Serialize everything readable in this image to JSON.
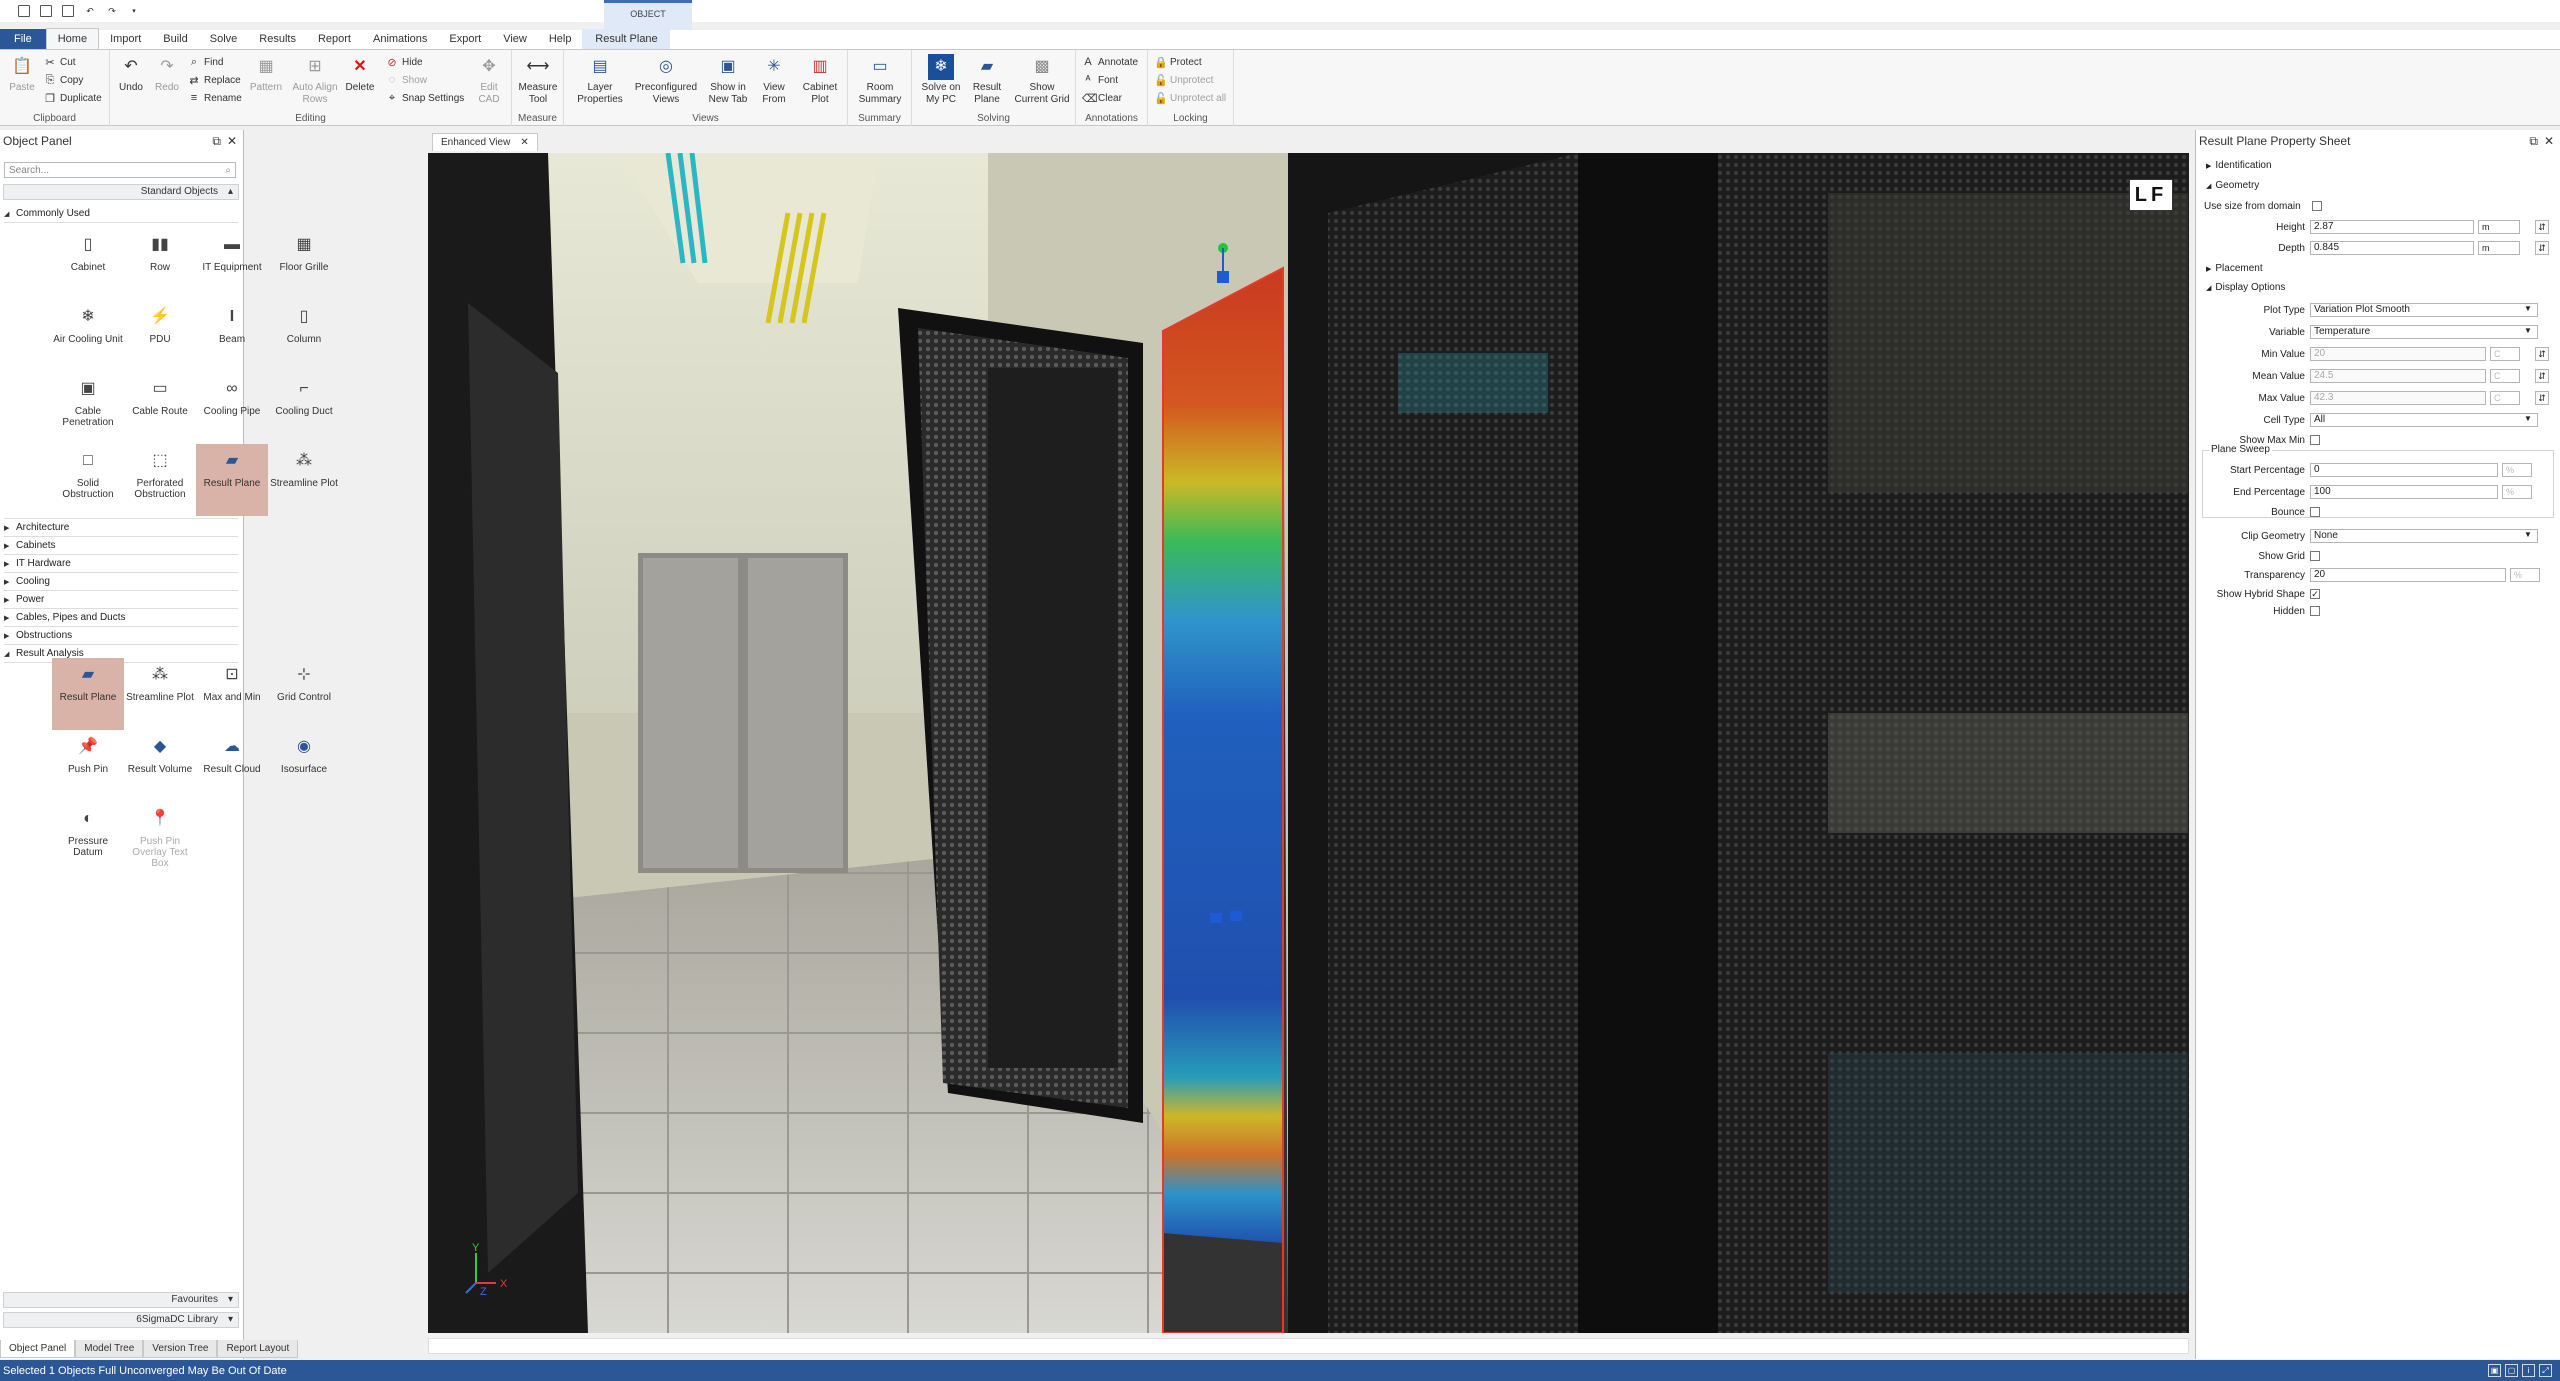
{
  "context_tab": {
    "group_label": "OBJECT"
  },
  "tabs": [
    {
      "label": "File"
    },
    {
      "label": "Home"
    },
    {
      "label": "Import"
    },
    {
      "label": "Build"
    },
    {
      "label": "Solve"
    },
    {
      "label": "Results"
    },
    {
      "label": "Report"
    },
    {
      "label": "Animations"
    },
    {
      "label": "Export"
    },
    {
      "label": "View"
    },
    {
      "label": "Help"
    },
    {
      "label": "Result Plane"
    }
  ],
  "ribbon": {
    "clipboard": {
      "label": "Clipboard",
      "paste": "Paste",
      "cut": "Cut",
      "copy": "Copy",
      "duplicate": "Duplicate"
    },
    "editing": {
      "label": "Editing",
      "undo": "Undo",
      "redo": "Redo",
      "find": "Find",
      "replace": "Replace",
      "rename": "Rename",
      "pattern": "Pattern",
      "auto_align": "Auto Align Rows",
      "delete": "Delete",
      "hide": "Hide",
      "show": "Show",
      "snap_settings": "Snap Settings",
      "edit_cad": "Edit CAD"
    },
    "measure": {
      "label": "Measure",
      "measure_tool": "Measure Tool"
    },
    "views": {
      "label": "Views",
      "layer_properties": "Layer Properties",
      "preconfigured_views": "Preconfigured Views",
      "show_in_new_tab": "Show in New Tab",
      "view_from": "View From",
      "cabinet_plot": "Cabinet Plot"
    },
    "summary": {
      "label": "Summary",
      "room_summary": "Room Summary"
    },
    "solving": {
      "label": "Solving",
      "solve_on_my_pc": "Solve on My PC",
      "result_plane": "Result Plane",
      "show_current_grid": "Show Current Grid"
    },
    "annotations": {
      "label": "Annotations",
      "annotate": "Annotate",
      "font": "Font",
      "clear": "Clear"
    },
    "locking": {
      "label": "Locking",
      "protect": "Protect",
      "unprotect": "Unprotect",
      "unprotect_all": "Unprotect all"
    }
  },
  "object_panel": {
    "title": "Object Panel",
    "search_placeholder": "Search...",
    "standard_objects": "Standard Objects",
    "commonly_used": "Commonly Used",
    "commonly_used_items": [
      "Cabinet",
      "Row",
      "IT Equipment",
      "Floor Grille",
      "Air Cooling Unit",
      "PDU",
      "Beam",
      "Column",
      "Cable Penetration",
      "Cable Route",
      "Cooling Pipe",
      "Cooling Duct",
      "Solid Obstruction",
      "Perforated Obstruction",
      "Result Plane",
      "Streamline Plot"
    ],
    "categories": [
      "Architecture",
      "Cabinets",
      "IT Hardware",
      "Cooling",
      "Power",
      "Cables, Pipes and Ducts",
      "Obstructions"
    ],
    "result_analysis": "Result Analysis",
    "result_analysis_items": [
      "Result Plane",
      "Streamline Plot",
      "Max and Min",
      "Grid Control",
      "Push Pin",
      "Result Volume",
      "Result Cloud",
      "Isosurface",
      "Pressure Datum",
      "Push Pin Overlay Text Box"
    ],
    "favourites": "Favourites",
    "library": "6SigmaDC Library"
  },
  "bottom_tabs": [
    "Object Panel",
    "Model Tree",
    "Version Tree",
    "Report Layout"
  ],
  "document_tab": {
    "label": "Enhanced View"
  },
  "viewport": {
    "badge": "LF",
    "axis_y": "Y",
    "axis_x": "X",
    "axis_z": "Z"
  },
  "property_sheet": {
    "title": "Result Plane Property Sheet",
    "identification": "Identification",
    "geometry": "Geometry",
    "use_size_from_domain_label": "Use size from domain",
    "height_label": "Height",
    "height_value": "2.87",
    "height_unit": "m",
    "depth_label": "Depth",
    "depth_value": "0.845",
    "depth_unit": "m",
    "placement": "Placement",
    "display_options": "Display Options",
    "plot_type_label": "Plot Type",
    "plot_type_value": "Variation Plot Smooth",
    "variable_label": "Variable",
    "variable_value": "Temperature",
    "min_value_label": "Min Value",
    "min_value": "20",
    "mean_value_label": "Mean Value",
    "mean_value": "24.5",
    "max_value_label": "Max Value",
    "max_value": "42.3",
    "temp_unit": "C",
    "cell_type_label": "Cell Type",
    "cell_type_value": "All",
    "show_max_min_label": "Show Max Min",
    "plane_sweep": "Plane Sweep",
    "start_pct_label": "Start Percentage",
    "start_pct_value": "0",
    "end_pct_label": "End Percentage",
    "end_pct_value": "100",
    "pct_unit": "%",
    "bounce_label": "Bounce",
    "clip_geometry_label": "Clip Geometry",
    "clip_geometry_value": "None",
    "show_grid_label": "Show Grid",
    "transparency_label": "Transparency",
    "transparency_value": "20",
    "show_hybrid_shape_label": "Show Hybrid Shape",
    "hidden_label": "Hidden"
  },
  "status": {
    "text": "Selected 1 Objects Full Unconverged May Be Out Of Date"
  }
}
